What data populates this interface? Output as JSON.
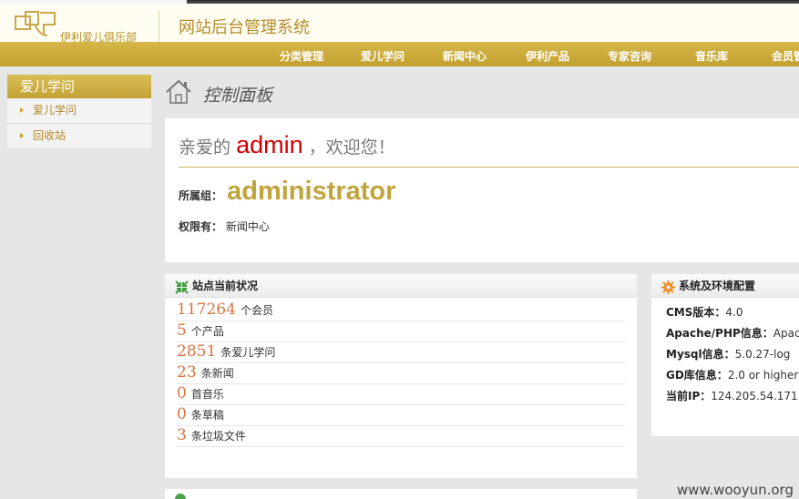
{
  "header": {
    "brand": "伊利爱儿俱乐部",
    "system_title": "网站后台管理系统"
  },
  "nav": {
    "items": [
      "分类管理",
      "爱儿学问",
      "新闻中心",
      "伊利产品",
      "专家咨询",
      "音乐库",
      "会员管"
    ]
  },
  "sidebar": {
    "title": "爱儿学问",
    "items": [
      "爱儿学问",
      "回收站"
    ]
  },
  "main": {
    "page_title": "控制面板",
    "welcome": {
      "prefix": "亲爱的",
      "username": "admin",
      "suffix": "，欢迎您！",
      "group_label": "所属组：",
      "group_value": "administrator",
      "perm_label": "权限有：",
      "perm_value": "新闻中心"
    },
    "stats": {
      "title": "站点当前状况",
      "rows": [
        {
          "num": "117264",
          "label": "个会员"
        },
        {
          "num": "5",
          "label": "个产品"
        },
        {
          "num": "2851",
          "label": "条爱儿学问"
        },
        {
          "num": "23",
          "label": "条新闻"
        },
        {
          "num": "0",
          "label": "首音乐"
        },
        {
          "num": "0",
          "label": "条草稿"
        },
        {
          "num": "3",
          "label": "条垃圾文件"
        }
      ]
    },
    "env": {
      "title": "系统及环境配置",
      "rows": [
        {
          "key": "CMS版本：",
          "value": "4.0"
        },
        {
          "key": "Apache/PHP信息：",
          "value": "Apach"
        },
        {
          "key": "Mysql信息：",
          "value": "5.0.27-log"
        },
        {
          "key": "GD库信息：",
          "value": "2.0 or higher"
        },
        {
          "key": "当前IP：",
          "value": "124.205.54.171"
        }
      ]
    }
  },
  "watermark": "www.wooyun.org",
  "colors": {
    "gold": "#c2a031",
    "accent_red": "#d00000",
    "stat_orange": "#d8743f"
  }
}
